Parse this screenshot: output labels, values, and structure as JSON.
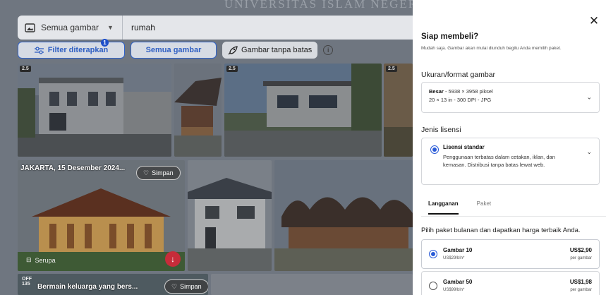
{
  "watermark": "UNIVERSITAS ISLAM NEGERI",
  "search": {
    "type_label": "Semua gambar",
    "query": "rumah"
  },
  "filters": {
    "filter_label": "Filter diterapkan",
    "filter_count": "1",
    "all_images_label": "Semua gambar",
    "unlimited_label": "Gambar tanpa batas"
  },
  "tiles": {
    "caption_jakarta": "JAKARTA, 15 Desember 2024...",
    "save_label": "Simpan",
    "similar_label": "Serupa",
    "caption_bottom": "Bermain keluarga yang bers...",
    "off_badge_top": "OFF",
    "off_badge_bottom": "135"
  },
  "panel": {
    "title": "Siap membeli?",
    "subtitle": "Mudah saja. Gambar akan mulai diunduh begitu Anda memilih paket.",
    "format_label": "Ukuran/format gambar",
    "format_size_name": "Besar",
    "format_size_detail": " - 5938 × 3958 piksel",
    "format_line2": "20 × 13 in - 300 DPI - JPG",
    "license_label": "Jenis lisensi",
    "license_title": "Lisensi standar",
    "license_desc": "Penggunaan terbatas dalam cetakan, iklan, dan kemasan. Distribusi tanpa batas lewat web.",
    "tabs": [
      {
        "label": "Langganan"
      },
      {
        "label": "Paket"
      }
    ],
    "pack_hint": "Pilih paket bulanan dan dapatkan harga terbaik Anda.",
    "plans": [
      {
        "name": "Gambar 10",
        "per_month": "US$29/bln*",
        "price": "US$2,90",
        "unit": "per gambar"
      },
      {
        "name": "Gambar 50",
        "per_month": "US$99/bln*",
        "price": "US$1,98",
        "unit": "per gambar"
      }
    ]
  },
  "colors": {
    "accent": "#2a5bd7",
    "download": "#c72c3a",
    "overlay": "#6f7680"
  }
}
